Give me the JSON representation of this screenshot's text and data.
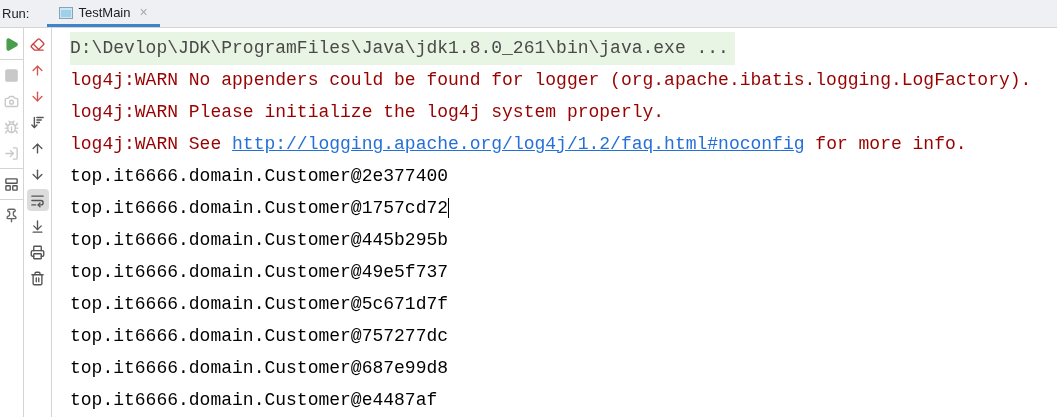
{
  "header": {
    "label": "Run:",
    "tabs": [
      {
        "label": "TestMain",
        "close": "×",
        "selected": true
      }
    ]
  },
  "toolbar": {
    "soft_wrap": {
      "on": true
    }
  },
  "console": {
    "lines": [
      {
        "caret": false,
        "segments": [
          {
            "kind": "command",
            "text": "D:\\Devlop\\JDK\\ProgramFiles\\Java\\jdk1.8.0_261\\bin\\java.exe ..."
          }
        ]
      },
      {
        "caret": false,
        "segments": [
          {
            "kind": "warn",
            "text": "log4j:WARN No appenders could be found for logger (org.apache.ibatis.logging.LogFactory)."
          }
        ]
      },
      {
        "caret": false,
        "segments": [
          {
            "kind": "warn",
            "text": "log4j:WARN Please initialize the log4j system properly."
          }
        ]
      },
      {
        "caret": false,
        "segments": [
          {
            "kind": "warn",
            "text": "log4j:WARN See "
          },
          {
            "kind": "link",
            "text": "http://logging.apache.org/log4j/1.2/faq.html#noconfig"
          },
          {
            "kind": "warn",
            "text": " for more info."
          }
        ]
      },
      {
        "caret": false,
        "segments": [
          {
            "kind": "out",
            "text": "top.it6666.domain.Customer@2e377400"
          }
        ]
      },
      {
        "caret": true,
        "segments": [
          {
            "kind": "out",
            "text": "top.it6666.domain.Customer@1757cd72"
          }
        ]
      },
      {
        "caret": false,
        "segments": [
          {
            "kind": "out",
            "text": "top.it6666.domain.Customer@445b295b"
          }
        ]
      },
      {
        "caret": false,
        "segments": [
          {
            "kind": "out",
            "text": "top.it6666.domain.Customer@49e5f737"
          }
        ]
      },
      {
        "caret": false,
        "segments": [
          {
            "kind": "out",
            "text": "top.it6666.domain.Customer@5c671d7f"
          }
        ]
      },
      {
        "caret": false,
        "segments": [
          {
            "kind": "out",
            "text": "top.it6666.domain.Customer@757277dc"
          }
        ]
      },
      {
        "caret": false,
        "segments": [
          {
            "kind": "out",
            "text": "top.it6666.domain.Customer@687e99d8"
          }
        ]
      },
      {
        "caret": false,
        "segments": [
          {
            "kind": "out",
            "text": "top.it6666.domain.Customer@e4487af"
          }
        ]
      }
    ]
  }
}
